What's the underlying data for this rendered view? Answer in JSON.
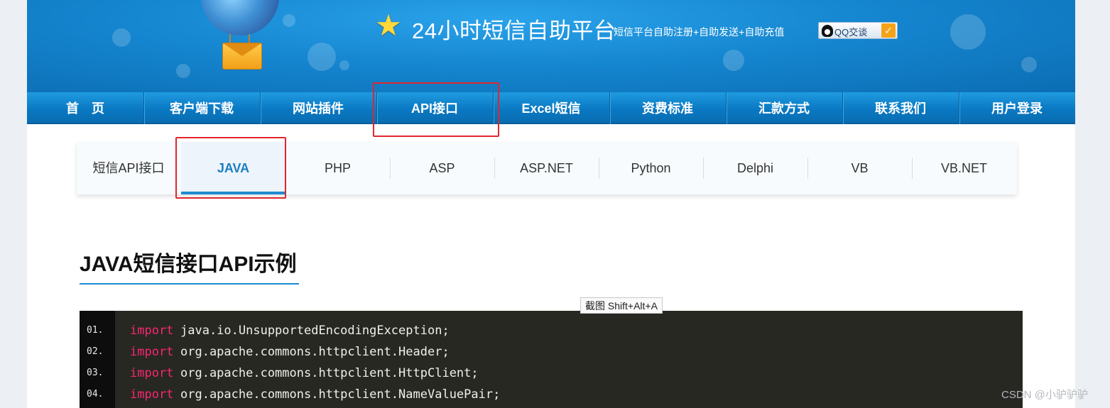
{
  "header": {
    "title": "24小时短信自助平台",
    "subtitle": "短信平台自助注册+自助发送+自助充值",
    "qq_label": "QQ交谈",
    "icons": [
      "star-icon",
      "balloon-logo",
      "envelope-icon",
      "qq-penguin-icon",
      "check-shield-icon"
    ]
  },
  "nav": {
    "items": [
      {
        "label": "首　页"
      },
      {
        "label": "客户端下载"
      },
      {
        "label": "网站插件"
      },
      {
        "label": "API接口"
      },
      {
        "label": "Excel短信"
      },
      {
        "label": "资费标准"
      },
      {
        "label": "汇款方式"
      },
      {
        "label": "联系我们"
      },
      {
        "label": "用户登录"
      }
    ],
    "highlighted": "API接口"
  },
  "sub_tabs": {
    "section_label": "短信API接口",
    "active": "JAVA",
    "tabs": [
      {
        "label": "JAVA"
      },
      {
        "label": "PHP"
      },
      {
        "label": "ASP"
      },
      {
        "label": "ASP.NET"
      },
      {
        "label": "Python"
      },
      {
        "label": "Delphi"
      },
      {
        "label": "VB"
      },
      {
        "label": "VB.NET"
      }
    ]
  },
  "content": {
    "heading": "JAVA短信接口API示例",
    "code_lines": [
      {
        "no": "01.",
        "keyword": "import",
        "text": "java.io.UnsupportedEncodingException;"
      },
      {
        "no": "02.",
        "keyword": "import",
        "text": "org.apache.commons.httpclient.Header;"
      },
      {
        "no": "03.",
        "keyword": "import",
        "text": "org.apache.commons.httpclient.HttpClient;"
      },
      {
        "no": "04.",
        "keyword": "import",
        "text": "org.apache.commons.httpclient.NameValuePair;"
      }
    ]
  },
  "tooltip": "截图 Shift+Alt+A",
  "watermark": "CSDN @小驴驴驴",
  "colors": {
    "highlight_border": "#e0262e",
    "nav_bg": "#0a79c3",
    "active_tab_text": "#1a7fc1",
    "code_bg": "#272822",
    "code_keyword": "#f92672"
  }
}
